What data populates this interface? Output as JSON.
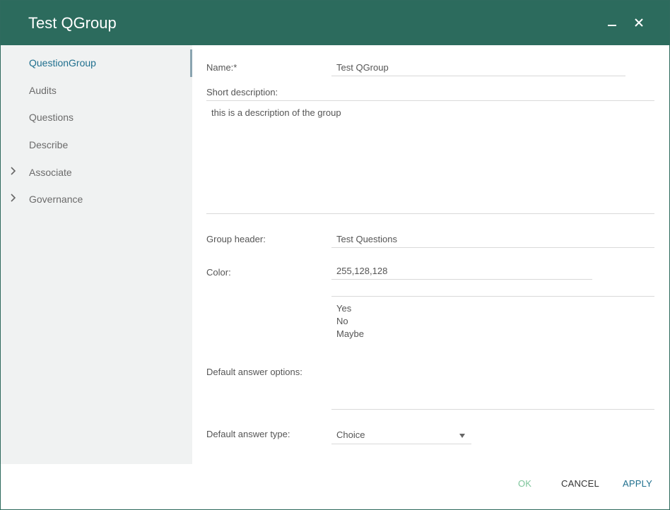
{
  "window": {
    "title": "Test QGroup",
    "minimize_icon": "minimize-icon",
    "close_icon": "close-icon"
  },
  "sidebar": {
    "items": [
      {
        "label": "QuestionGroup",
        "active": true,
        "expandable": false
      },
      {
        "label": "Audits",
        "active": false,
        "expandable": false
      },
      {
        "label": "Questions",
        "active": false,
        "expandable": false
      },
      {
        "label": "Describe",
        "active": false,
        "expandable": false
      },
      {
        "label": "Associate",
        "active": false,
        "expandable": true
      },
      {
        "label": "Governance",
        "active": false,
        "expandable": true
      }
    ]
  },
  "form": {
    "name_label": "Name:*",
    "name_value": "Test QGroup",
    "short_description_label": "Short description:",
    "short_description_value": "this is a description of the group",
    "group_header_label": "Group header:",
    "group_header_value": "Test Questions",
    "color_label": "Color:",
    "color_value": "255,128,128",
    "default_answer_options_label": "Default answer options:",
    "default_answer_options": [
      "Yes",
      "No",
      "Maybe"
    ],
    "default_answer_type_label": "Default answer type:",
    "default_answer_type_value": "Choice"
  },
  "footer": {
    "ok_label": "OK",
    "cancel_label": "CANCEL",
    "apply_label": "APPLY"
  },
  "colors": {
    "titlebar": "#2c6b5d",
    "accent": "#1f6f8e",
    "ok_disabled": "#7cc49a",
    "sidebar_bg": "#f0f2f2"
  }
}
